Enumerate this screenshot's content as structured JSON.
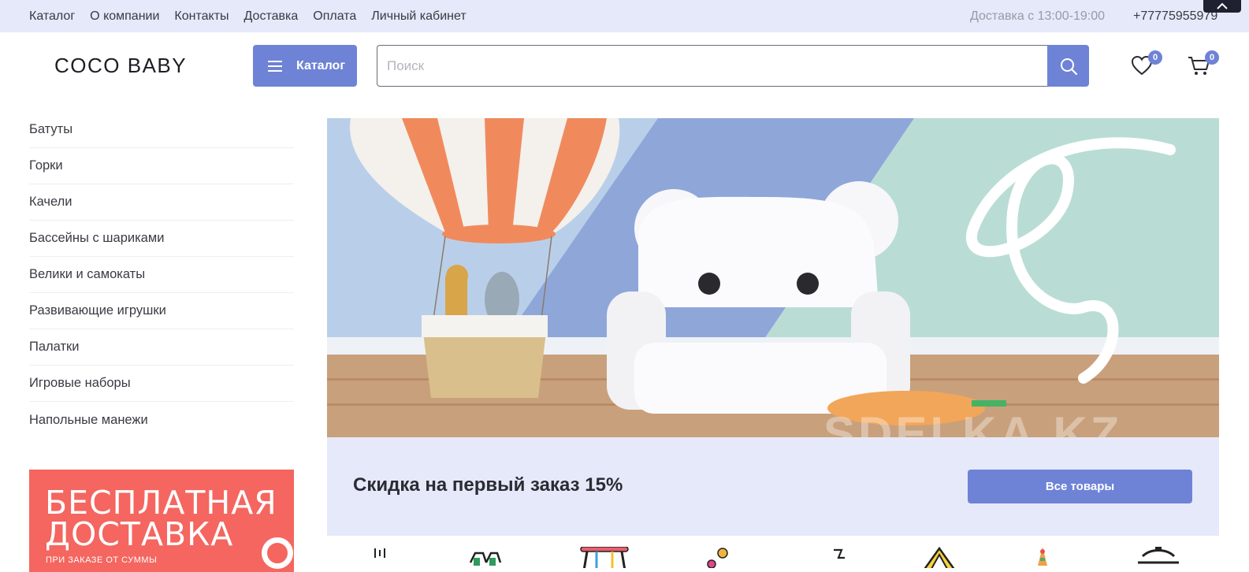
{
  "top_nav": {
    "items": [
      "Каталог",
      "О компании",
      "Контакты",
      "Доставка",
      "Оплата",
      "Личный кабинет"
    ],
    "delivery_hours": "Доставка с 13:00-19:00",
    "phone": "+77775955979"
  },
  "header": {
    "logo": "COCO BABY",
    "catalog_button": "Каталог",
    "search_placeholder": "Поиск",
    "wishlist_count": "0",
    "cart_count": "0"
  },
  "sidebar": {
    "items": [
      "Батуты",
      "Горки",
      "Качели",
      "Бассейны с шариками",
      "Велики и самокаты",
      "Развивающие игрушки",
      "Палатки",
      "Игровые наборы",
      "Напольные манежи"
    ],
    "promo": {
      "line1": "БЕСПЛАТНАЯ",
      "line2": "ДОСТАВКА",
      "line3": "ПРИ ЗАКАЗЕ ОТ СУММЫ"
    }
  },
  "banner": {
    "watermark": "SDELKA.KZ",
    "offer_title": "Скидка на первый заказ 15%",
    "offer_button": "Все товары"
  },
  "colors": {
    "accent": "#6e83d6",
    "topbar_bg": "#e6e9fa",
    "promo_bg": "#f4665f"
  },
  "category_icons": [
    "trampoline-icon",
    "slide-icon",
    "swing-icon",
    "ball-pool-icon",
    "scooter-icon",
    "tent-icon",
    "toy-icon",
    "playpen-icon"
  ]
}
